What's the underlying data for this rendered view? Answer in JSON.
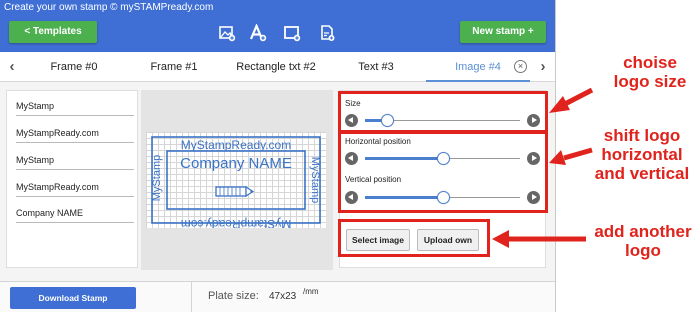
{
  "titlebar": {
    "title": "Create your own stamp © mySTAMPready.com"
  },
  "toolbar": {
    "templates_label": "<  Templates",
    "new_stamp_label": "New stamp +",
    "tools": [
      "add-image-icon",
      "add-text-icon",
      "add-frame-icon",
      "add-file-icon"
    ]
  },
  "tabs": {
    "items": [
      {
        "label": "Frame #0"
      },
      {
        "label": "Frame #1"
      },
      {
        "label": "Rectangle txt #2"
      },
      {
        "label": "Text #3"
      },
      {
        "label": "Image #4",
        "active": true
      }
    ],
    "close_symbol": "×"
  },
  "text_lines": [
    "MyStamp",
    "MyStampReady.com",
    "MyStamp",
    "MyStampReady.com",
    "Company NAME"
  ],
  "stamp": {
    "top_text": "MyStampReady.com",
    "center_text": "Company NAME",
    "bottom_text": "MyStampReady.com",
    "left_text": "MyStamp",
    "right_text": "MyStamp",
    "ink_color": "#3b73c7"
  },
  "settings": {
    "size_label": "Size",
    "size_value": 0.14,
    "horizontal_label": "Horizontal position",
    "horizontal_value": 0.5,
    "vertical_label": "Vertical position",
    "vertical_value": 0.5,
    "select_image_label": "Select image",
    "upload_own_label": "Upload own"
  },
  "footer": {
    "download_label": "Download Stamp",
    "plate_label": "Plate size:",
    "plate_value": "47x23",
    "plate_unit": "/mm"
  },
  "annotations": {
    "color": "#e0231c",
    "logo_size": "choise\nlogo size",
    "shift_logo": "shift logo\nhorizontal\nand vertical",
    "add_logo": "add another\nlogo"
  }
}
